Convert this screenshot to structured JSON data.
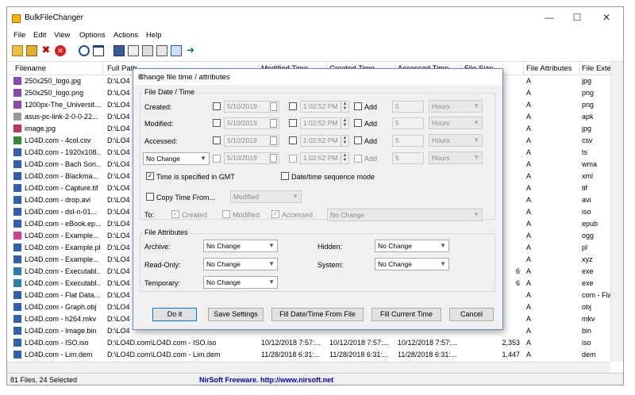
{
  "app": {
    "title": "BulkFileChanger"
  },
  "menu": [
    "File",
    "Edit",
    "View",
    "Options",
    "Actions",
    "Help"
  ],
  "toolbar_icons": [
    "open-folder-icon",
    "add-files-icon",
    "remove-icon",
    "delete-icon",
    "properties-icon",
    "window-icon",
    "save-icon",
    "copy-icon",
    "paste-icon",
    "html-report-icon",
    "find-icon",
    "exit-icon"
  ],
  "columns": [
    "Filename",
    "Full Path",
    "Modified Time",
    "Created Time",
    "Accessed Time",
    "File Size",
    "File Attributes",
    "File Extens"
  ],
  "rows": [
    {
      "name": "250x250_logo.jpg",
      "path": "D:\\LO4",
      "size": "",
      "attr": "A",
      "ext": "jpg",
      "icon": "#8a4ab0"
    },
    {
      "name": "250x250_logo.png",
      "path": "D:\\LO4",
      "size": "",
      "attr": "A",
      "ext": "png",
      "icon": "#8a4ab0"
    },
    {
      "name": "1200px-The_Universit...",
      "path": "D:\\LO4",
      "size": "",
      "attr": "A",
      "ext": "png",
      "icon": "#8a4ab0"
    },
    {
      "name": "asus-pc-link-2-0-0-22...",
      "path": "D:\\LO4",
      "size": "",
      "attr": "A",
      "ext": "apk",
      "icon": "#9a9a9a"
    },
    {
      "name": "image.jpg",
      "path": "D:\\LO4",
      "size": "",
      "attr": "A",
      "ext": "jpg",
      "icon": "#c03060"
    },
    {
      "name": "LO4D.com - 4col.csv",
      "path": "D:\\LO4",
      "size": "",
      "attr": "A",
      "ext": "csv",
      "icon": "#2f8a3a"
    },
    {
      "name": "LO4D.com - 1920x108...",
      "path": "D:\\LO4",
      "size": "",
      "attr": "A",
      "ext": "ts",
      "icon": "#3060b0"
    },
    {
      "name": "LO4D.com - Bach Son...",
      "path": "D:\\LO4",
      "size": "",
      "attr": "A",
      "ext": "wma",
      "icon": "#3060b0"
    },
    {
      "name": "LO4D.com - Blackma...",
      "path": "D:\\LO4",
      "size": "",
      "attr": "A",
      "ext": "xml",
      "icon": "#3060b0"
    },
    {
      "name": "LO4D.com - Capture.tif",
      "path": "D:\\LO4",
      "size": "",
      "attr": "A",
      "ext": "tif",
      "icon": "#3060b0"
    },
    {
      "name": "LO4D.com - drop.avi",
      "path": "D:\\LO4",
      "size": "",
      "attr": "A",
      "ext": "avi",
      "icon": "#3060b0"
    },
    {
      "name": "LO4D.com - dsl-n-01...",
      "path": "D:\\LO4",
      "size": "",
      "attr": "A",
      "ext": "iso",
      "icon": "#3060b0"
    },
    {
      "name": "LO4D.com - eBook.ep...",
      "path": "D:\\LO4",
      "size": "",
      "attr": "A",
      "ext": "epub",
      "icon": "#3060b0"
    },
    {
      "name": "LO4D.com - Example...",
      "path": "D:\\LO4",
      "size": "",
      "attr": "A",
      "ext": "ogg",
      "icon": "#d04090"
    },
    {
      "name": "LO4D.com - Example.pl",
      "path": "D:\\LO4",
      "size": "",
      "attr": "A",
      "ext": "pl",
      "icon": "#3060b0"
    },
    {
      "name": "LO4D.com - Example...",
      "path": "D:\\LO4",
      "size": "",
      "attr": "A",
      "ext": "xyz",
      "icon": "#3060b0"
    },
    {
      "name": "LO4D.com - Executabl...",
      "path": "D:\\LO4",
      "size": "6",
      "attr": "A",
      "ext": "exe",
      "icon": "#2a7fb0"
    },
    {
      "name": "LO4D.com - Executabl...",
      "path": "D:\\LO4",
      "size": "6",
      "attr": "A",
      "ext": "exe",
      "icon": "#2a7fb0"
    },
    {
      "name": "LO4D.com - Flat Data...",
      "path": "D:\\LO4",
      "size": "",
      "attr": "A",
      "ext": "com - Flat",
      "icon": "#3060b0"
    },
    {
      "name": "LO4D.com - Graph.obj",
      "path": "D:\\LO4",
      "size": "",
      "attr": "A",
      "ext": "obj",
      "icon": "#3060b0"
    },
    {
      "name": "LO4D.com - h264.mkv",
      "path": "D:\\LO4",
      "size": "",
      "attr": "A",
      "ext": "mkv",
      "icon": "#3060b0"
    },
    {
      "name": "LO4D.com - Image.bin",
      "path": "D:\\LO4",
      "size": "",
      "attr": "A",
      "ext": "bin",
      "icon": "#3060b0"
    },
    {
      "name": "LO4D.com - ISO.iso",
      "path": "D:\\LO4D.com\\LO4D.com - ISO.iso",
      "mod": "10/12/2018 7:57:...",
      "created": "10/12/2018 7:57:...",
      "acc": "10/12/2018 7:57:...",
      "size": "2,353",
      "attr": "A",
      "ext": "iso",
      "icon": "#3060b0"
    },
    {
      "name": "LO4D.com - Lim.dem",
      "path": "D:\\LO4D.com\\LO4D.com - Lim.dem",
      "mod": "11/28/2018 6:31:...",
      "created": "11/28/2018 6:31:...",
      "acc": "11/28/2018 6:31:...",
      "size": "1,447",
      "attr": "A",
      "ext": "dem",
      "icon": "#3060b0"
    }
  ],
  "status": {
    "count": "81 Files, 24 Selected",
    "credit": "NirSoft Freeware.  http://www.nirsoft.net",
    "credit_color": "#0000c0"
  },
  "dialog": {
    "title": "Change file time / attributes",
    "date_group": "File Date / Time",
    "created_label": "Created:",
    "modified_label": "Modified:",
    "accessed_label": "Accessed:",
    "date_value": "5/10/2019",
    "time_value": "1:02:52 PM",
    "add_label": "Add",
    "add_amount": "5",
    "unit": "Hours",
    "no_change": "No Change",
    "gmt_label": "Time is specified in GMT",
    "seq_label": "Date/time sequence mode",
    "copy_from_label": "Copy Time From...",
    "copy_from_value": "Modified",
    "to_label": "To:",
    "to_created": "Created",
    "to_modified": "Modified",
    "to_accessed": "Accessed",
    "to_combo": "No Change",
    "attr_group": "File Attributes",
    "archive_label": "Archive:",
    "readonly_label": "Read-Only:",
    "temporary_label": "Temporary:",
    "hidden_label": "Hidden:",
    "system_label": "System:",
    "buttons": {
      "doit": "Do it",
      "save": "Save Settings",
      "fill_file": "Fill Date/Time From File",
      "fill_current": "Fill Current Time",
      "cancel": "Cancel"
    }
  }
}
